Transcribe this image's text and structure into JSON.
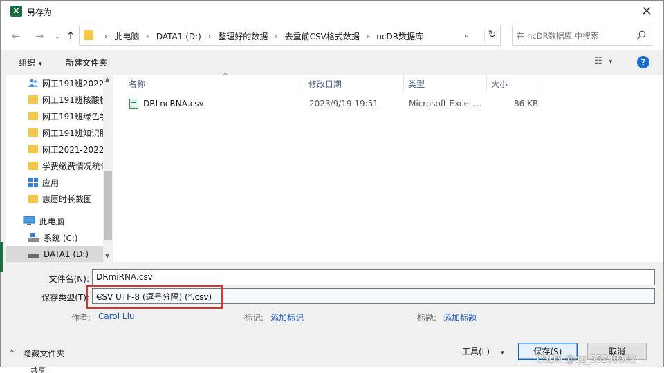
{
  "window": {
    "title": "另存为",
    "app_icon": "excel-icon",
    "close_glyph": "✕"
  },
  "nav": {
    "back_glyph": "←",
    "forward_glyph": "→",
    "dropdown_glyph": "⌄",
    "up_glyph": "↑",
    "breadcrumbs": [
      "此电脑",
      "DATA1 (D:)",
      "整理好的数据",
      "去重前CSV格式数据",
      "ncDR数据库"
    ],
    "separator": "›",
    "refresh_glyph": "↻",
    "search_placeholder": "在 ncDR数据库 中搜索"
  },
  "toolbar": {
    "organize_label": "组织",
    "caret": "▾",
    "new_folder_label": "新建文件夹",
    "view_glyph": "☷",
    "help_glyph": "?"
  },
  "sidebar": {
    "items": [
      {
        "label": "网工191班2022",
        "icon": "user-folder-icon"
      },
      {
        "label": "网工191班核酸检",
        "icon": "folder-icon"
      },
      {
        "label": "网工191班绿色学",
        "icon": "folder-icon"
      },
      {
        "label": "网工191班知识服",
        "icon": "folder-icon"
      },
      {
        "label": "网工2021-2022",
        "icon": "folder-icon"
      },
      {
        "label": "学费缴费情况统计",
        "icon": "folder-icon"
      },
      {
        "label": "应用",
        "icon": "apps-icon"
      },
      {
        "label": "志愿时长截图",
        "icon": "folder-icon"
      },
      {
        "label": "此电脑",
        "icon": "computer-icon"
      },
      {
        "label": "系统 (C:)",
        "icon": "drive-icon"
      },
      {
        "label": "DATA1 (D:)",
        "icon": "drive-icon",
        "selected": true
      }
    ]
  },
  "file_list": {
    "columns": [
      "名称",
      "修改日期",
      "类型",
      "大小"
    ],
    "sort_glyph": "^",
    "rows": [
      {
        "name": "DRLncRNA.csv",
        "modified": "2023/9/19 19:51",
        "type": "Microsoft Excel ...",
        "size": "86 KB"
      }
    ]
  },
  "form": {
    "filename_label": "文件名(N):",
    "filename_value": "DRmiRNA.csv",
    "filetype_label": "保存类型(T):",
    "filetype_value": "CSV UTF-8 (逗号分隔) (*.csv)",
    "author_label": "作者:",
    "author_value": "Carol Liu",
    "tags_label": "标记:",
    "tags_link": "添加标记",
    "title_label": "标题:",
    "title_link": "添加标题",
    "highlight_color": "#e03030"
  },
  "footer": {
    "hide_folders_label": "隐藏文件夹",
    "chevron_glyph": "^",
    "tools_label": "工具(L)",
    "save_label": "保存(S)",
    "cancel_label": "取消",
    "watermark": "CSDN @qq_53298802",
    "behind_text": "共享"
  },
  "colors": {
    "accent": "#0a64c8",
    "folder": "#f3c84b",
    "excel_green": "#1d6f42",
    "link": "#1a56c0"
  }
}
